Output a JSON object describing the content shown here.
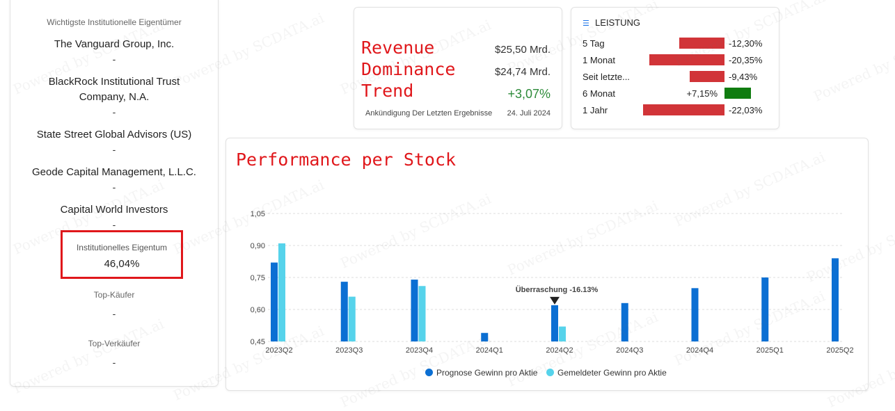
{
  "owners": {
    "header": "Wichtigste Institutionelle Eigentümer",
    "items": [
      {
        "name": "The Vanguard Group, Inc.",
        "value": "-"
      },
      {
        "name": "BlackRock Institutional Trust Company, N.A.",
        "value": "-"
      },
      {
        "name": "State Street Global Advisors (US)",
        "value": "-"
      },
      {
        "name": "Geode Capital Management, L.L.C.",
        "value": "-"
      },
      {
        "name": "Capital World Investors",
        "value": "-"
      }
    ],
    "institutional_label": "Institutionelles Eigentum",
    "institutional_value": "46,04%",
    "top_buyers_label": "Top-Käufer",
    "top_buyers_value": "-",
    "top_sellers_label": "Top-Verkäufer",
    "top_sellers_value": "-"
  },
  "revenue": {
    "title": "Revenue\nDominance\nTrend",
    "value1": "$25,50 Mrd.",
    "value2": "$24,74 Mrd.",
    "change": "+3,07%",
    "announcement_label": "Ankündigung Der Letzten Ergebnisse",
    "announcement_date": "24. Juli 2024"
  },
  "leistung": {
    "title": "LEISTUNG",
    "rows": [
      {
        "label": "5 Tag",
        "value": "-12,30%",
        "pct": -12.3
      },
      {
        "label": "1 Monat",
        "value": "-20,35%",
        "pct": -20.35
      },
      {
        "label": "Seit letzte...",
        "value": "-9,43%",
        "pct": -9.43
      },
      {
        "label": "6 Monat",
        "value": "+7,15%",
        "pct": 7.15
      },
      {
        "label": "1 Jahr",
        "value": "-22,03%",
        "pct": -22.03
      }
    ],
    "colors": {
      "negative": "#d13438",
      "positive": "#107c10"
    }
  },
  "chart_title": "Performance per Stock",
  "chart_data": {
    "type": "bar",
    "categories": [
      "2023Q2",
      "2023Q3",
      "2023Q4",
      "2024Q1",
      "2024Q2",
      "2024Q3",
      "2024Q4",
      "2025Q1",
      "2025Q2"
    ],
    "series": [
      {
        "name": "Prognose Gewinn pro Aktie",
        "color": "#0b6fd3",
        "values": [
          0.82,
          0.73,
          0.74,
          0.49,
          0.62,
          0.63,
          0.7,
          0.75,
          0.84
        ]
      },
      {
        "name": "Gemeldeter Gewinn pro Aktie",
        "color": "#56d3eb",
        "values": [
          0.91,
          0.66,
          0.71,
          null,
          0.52,
          null,
          null,
          null,
          null
        ]
      }
    ],
    "yticks": [
      "1,05",
      "0,90",
      "0,75",
      "0,60",
      "0,45"
    ],
    "ytick_values": [
      1.05,
      0.9,
      0.75,
      0.6,
      0.45
    ],
    "ylim": [
      0.45,
      1.05
    ],
    "grid": true,
    "legend": "bottom-center",
    "annotation": {
      "text": "Überraschung -16.13%",
      "category": "2024Q2"
    }
  },
  "watermark": "Powered by SCDATA.ai"
}
